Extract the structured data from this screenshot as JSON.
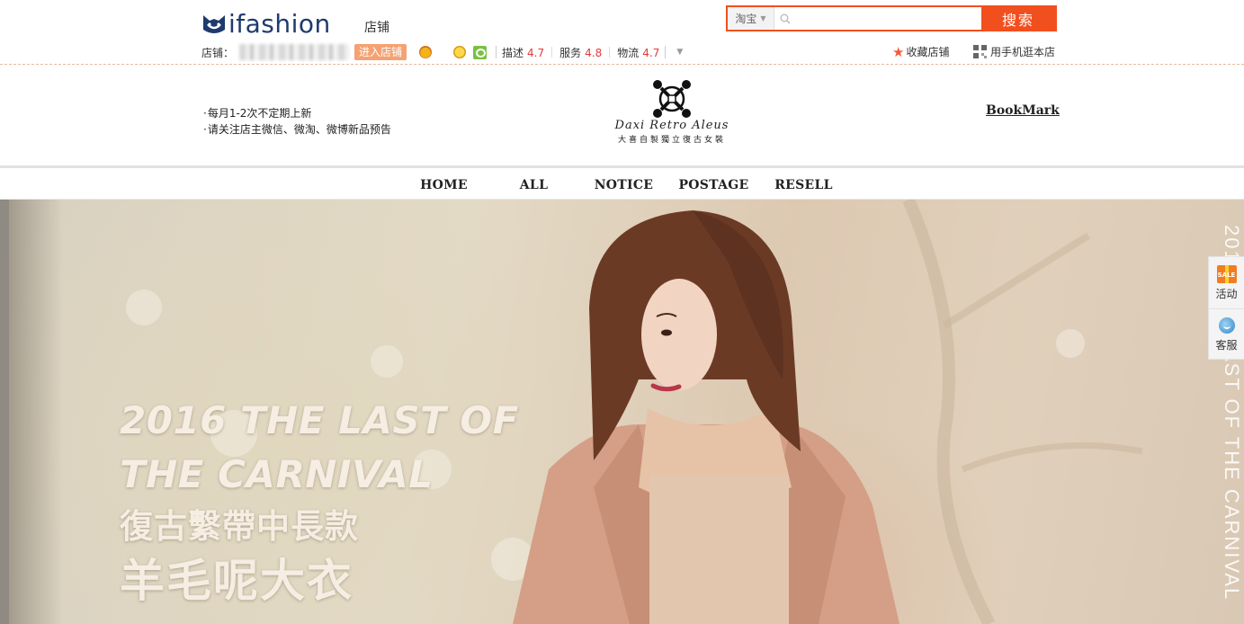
{
  "topbar": {
    "logo_text": "ifashion",
    "store_tag": "店铺",
    "shop_label": "店铺：",
    "enter_button": "进入店铺",
    "ratings": [
      {
        "label": "描述",
        "value": "4.7"
      },
      {
        "label": "服务",
        "value": "4.8"
      },
      {
        "label": "物流",
        "value": "4.7"
      }
    ],
    "expand_icon": "chevron-down-icon"
  },
  "search": {
    "scope": "淘宝",
    "placeholder": "",
    "button": "搜索"
  },
  "links": {
    "favorite": "收藏店铺",
    "mobile": "用手机逛本店"
  },
  "shop_header": {
    "notices": [
      "每月1-2次不定期上新",
      "请关注店主微信、微淘、微博新品预告"
    ],
    "brand_script": "Daxi Retro Aleus",
    "brand_sub": "大喜自製獨立復古女裝",
    "bookmark": "BookMark"
  },
  "nav": {
    "items": [
      "HOME",
      "ALL",
      "NOTICE",
      "POSTAGE",
      "RESELL"
    ]
  },
  "hero": {
    "line1": "2016 THE LAST OF",
    "line2": "THE CARNIVAL",
    "line3": "復古繫帶中長款",
    "line4": "羊毛呢大衣",
    "vertical": "2016 THE LAST OF THE CARNIVAL"
  },
  "side_float": {
    "activity": "活动",
    "activity_badge": "SALE",
    "service": "客服"
  },
  "colors": {
    "accent": "#f24f1e",
    "rating_value": "#e4393c",
    "enter_button": "#f4a273",
    "logo": "#1e3a6e"
  }
}
